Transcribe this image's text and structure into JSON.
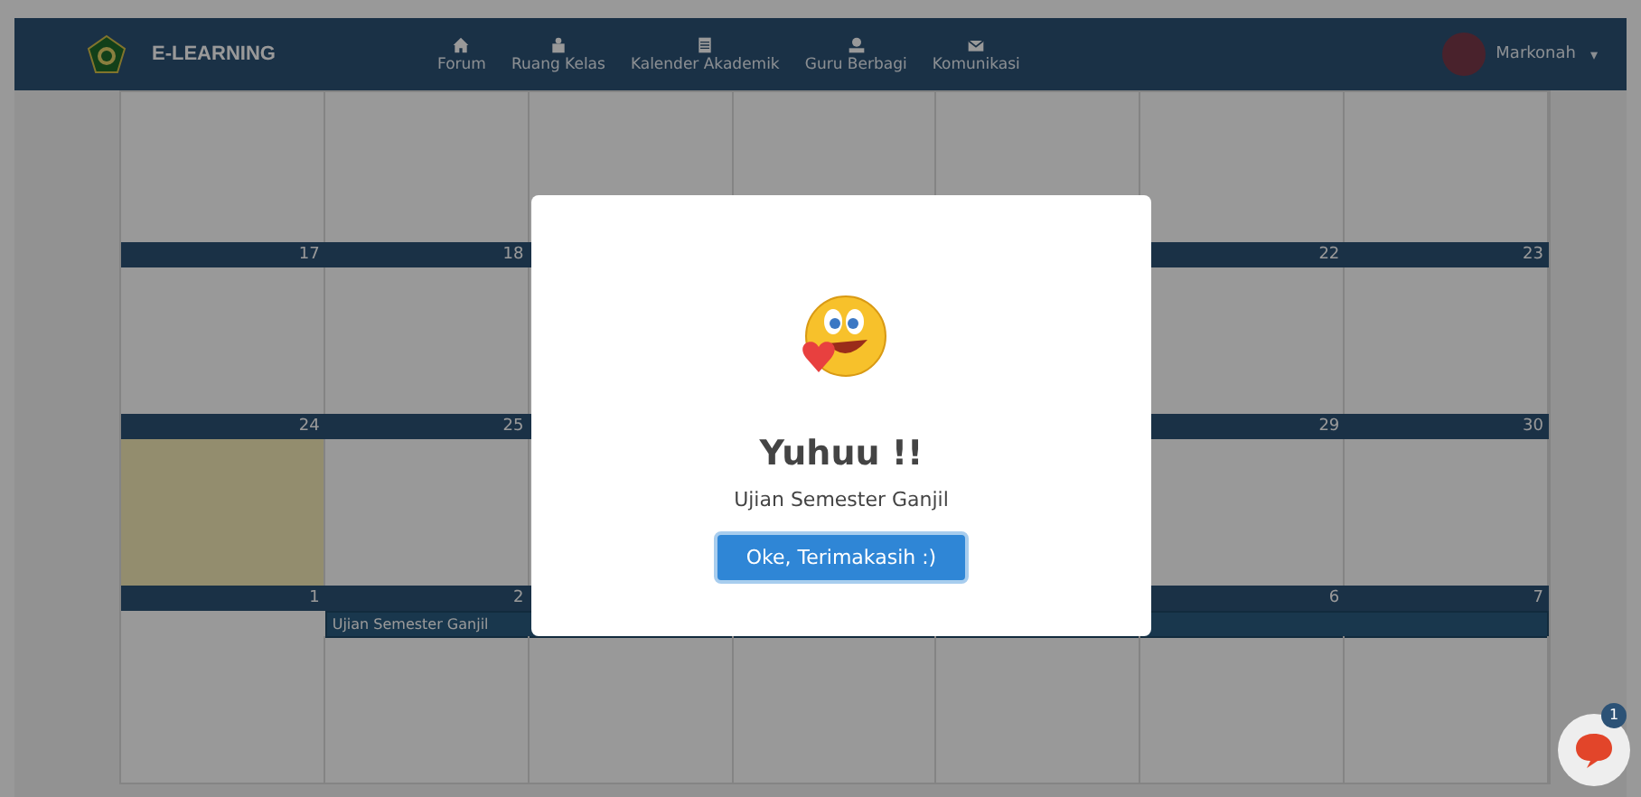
{
  "navbar": {
    "brand": "E-LEARNING",
    "items": [
      {
        "kind": "home",
        "label": "Forum"
      },
      {
        "kind": "class",
        "label": "Ruang Kelas"
      },
      {
        "kind": "calendar",
        "label": "Kalender Akademik"
      },
      {
        "kind": "teacher",
        "label": "Guru Berbagi"
      },
      {
        "kind": "mail",
        "label": "Komunikasi"
      }
    ],
    "user": {
      "name": "Markonah",
      "caret": "▾"
    }
  },
  "calendar": {
    "weeks": [
      {
        "left_days": [
          {
            "date": "17",
            "today": false
          },
          {
            "date": "18",
            "today": false
          }
        ],
        "right_days": [
          {
            "date": "22",
            "today": false
          },
          {
            "date": "23",
            "today": false
          }
        ]
      },
      {
        "left_days": [
          {
            "date": "24",
            "today": true
          },
          {
            "date": "25",
            "today": false
          }
        ],
        "right_days": [
          {
            "date": "29",
            "today": false
          },
          {
            "date": "30",
            "today": false
          }
        ]
      },
      {
        "left_days": [
          {
            "date": "1",
            "today": false
          },
          {
            "date": "2",
            "today": false
          }
        ],
        "right_days": [
          {
            "date": "6",
            "today": false
          },
          {
            "date": "7",
            "today": false
          }
        ],
        "events": [
          {
            "title": "Ujian Semester Ganjil"
          }
        ]
      }
    ]
  },
  "modal": {
    "title": "Yuhuu !!",
    "message": "Ujian Semester Ganjil",
    "button": "Oke, Terimakasih :)"
  },
  "chat": {
    "badge": "1"
  }
}
